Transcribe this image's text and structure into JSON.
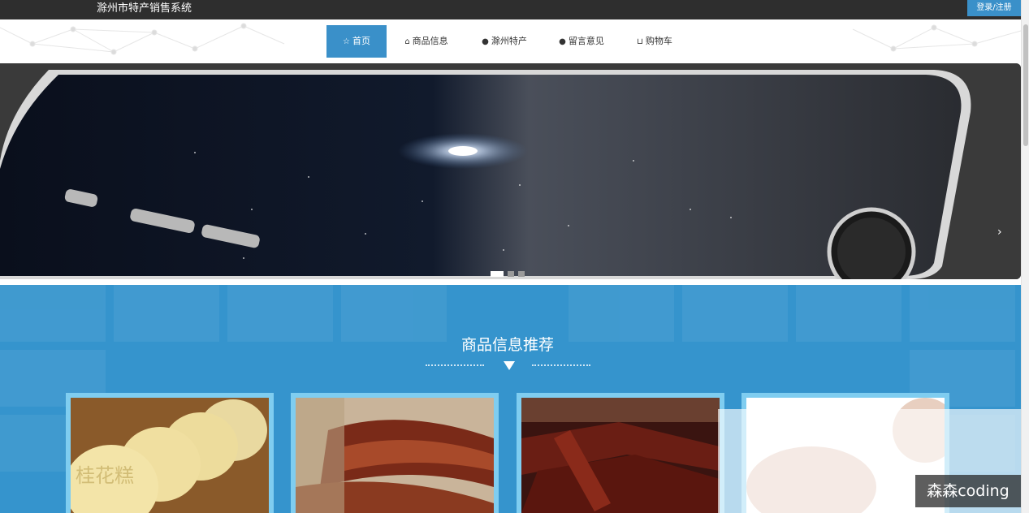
{
  "header": {
    "site_title": "滁州市特产销售系统",
    "login_label": "登录/注册"
  },
  "nav": {
    "items": [
      {
        "label": "首页",
        "icon": "star-icon",
        "active": true
      },
      {
        "label": "商品信息",
        "icon": "bag-icon",
        "active": false
      },
      {
        "label": "滁州特产",
        "icon": "info-icon",
        "active": false
      },
      {
        "label": "留言意见",
        "icon": "question-icon",
        "active": false
      },
      {
        "label": "购物车",
        "icon": "cart-icon",
        "active": false
      }
    ]
  },
  "banner": {
    "next_arrow": "›",
    "slides_total": 3,
    "active_slide": 1
  },
  "section": {
    "title": "商品信息推荐"
  },
  "products": [
    {
      "image": "osmanthus-cake",
      "image_text": "桂花糕"
    },
    {
      "image": "roasted-duck"
    },
    {
      "image": "dried-beef"
    },
    {
      "image": "blurred-product"
    }
  ],
  "watermark": "森森coding",
  "colors": {
    "topbar": "#2e2e2e",
    "accent": "#3a90c9",
    "section_bg": "#3594cd",
    "card_border": "#7fcdf0"
  }
}
